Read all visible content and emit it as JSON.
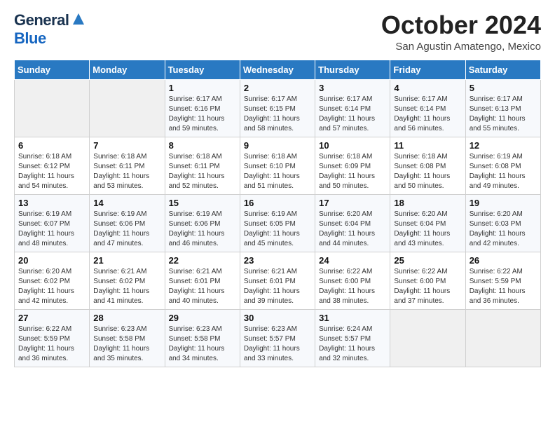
{
  "header": {
    "logo_general": "General",
    "logo_blue": "Blue",
    "month_title": "October 2024",
    "subtitle": "San Agustin Amatengo, Mexico"
  },
  "days_of_week": [
    "Sunday",
    "Monday",
    "Tuesday",
    "Wednesday",
    "Thursday",
    "Friday",
    "Saturday"
  ],
  "weeks": [
    [
      {
        "day": "",
        "sunrise": "",
        "sunset": "",
        "daylight": ""
      },
      {
        "day": "",
        "sunrise": "",
        "sunset": "",
        "daylight": ""
      },
      {
        "day": "1",
        "sunrise": "Sunrise: 6:17 AM",
        "sunset": "Sunset: 6:16 PM",
        "daylight": "Daylight: 11 hours and 59 minutes."
      },
      {
        "day": "2",
        "sunrise": "Sunrise: 6:17 AM",
        "sunset": "Sunset: 6:15 PM",
        "daylight": "Daylight: 11 hours and 58 minutes."
      },
      {
        "day": "3",
        "sunrise": "Sunrise: 6:17 AM",
        "sunset": "Sunset: 6:14 PM",
        "daylight": "Daylight: 11 hours and 57 minutes."
      },
      {
        "day": "4",
        "sunrise": "Sunrise: 6:17 AM",
        "sunset": "Sunset: 6:14 PM",
        "daylight": "Daylight: 11 hours and 56 minutes."
      },
      {
        "day": "5",
        "sunrise": "Sunrise: 6:17 AM",
        "sunset": "Sunset: 6:13 PM",
        "daylight": "Daylight: 11 hours and 55 minutes."
      }
    ],
    [
      {
        "day": "6",
        "sunrise": "Sunrise: 6:18 AM",
        "sunset": "Sunset: 6:12 PM",
        "daylight": "Daylight: 11 hours and 54 minutes."
      },
      {
        "day": "7",
        "sunrise": "Sunrise: 6:18 AM",
        "sunset": "Sunset: 6:11 PM",
        "daylight": "Daylight: 11 hours and 53 minutes."
      },
      {
        "day": "8",
        "sunrise": "Sunrise: 6:18 AM",
        "sunset": "Sunset: 6:11 PM",
        "daylight": "Daylight: 11 hours and 52 minutes."
      },
      {
        "day": "9",
        "sunrise": "Sunrise: 6:18 AM",
        "sunset": "Sunset: 6:10 PM",
        "daylight": "Daylight: 11 hours and 51 minutes."
      },
      {
        "day": "10",
        "sunrise": "Sunrise: 6:18 AM",
        "sunset": "Sunset: 6:09 PM",
        "daylight": "Daylight: 11 hours and 50 minutes."
      },
      {
        "day": "11",
        "sunrise": "Sunrise: 6:18 AM",
        "sunset": "Sunset: 6:08 PM",
        "daylight": "Daylight: 11 hours and 50 minutes."
      },
      {
        "day": "12",
        "sunrise": "Sunrise: 6:19 AM",
        "sunset": "Sunset: 6:08 PM",
        "daylight": "Daylight: 11 hours and 49 minutes."
      }
    ],
    [
      {
        "day": "13",
        "sunrise": "Sunrise: 6:19 AM",
        "sunset": "Sunset: 6:07 PM",
        "daylight": "Daylight: 11 hours and 48 minutes."
      },
      {
        "day": "14",
        "sunrise": "Sunrise: 6:19 AM",
        "sunset": "Sunset: 6:06 PM",
        "daylight": "Daylight: 11 hours and 47 minutes."
      },
      {
        "day": "15",
        "sunrise": "Sunrise: 6:19 AM",
        "sunset": "Sunset: 6:06 PM",
        "daylight": "Daylight: 11 hours and 46 minutes."
      },
      {
        "day": "16",
        "sunrise": "Sunrise: 6:19 AM",
        "sunset": "Sunset: 6:05 PM",
        "daylight": "Daylight: 11 hours and 45 minutes."
      },
      {
        "day": "17",
        "sunrise": "Sunrise: 6:20 AM",
        "sunset": "Sunset: 6:04 PM",
        "daylight": "Daylight: 11 hours and 44 minutes."
      },
      {
        "day": "18",
        "sunrise": "Sunrise: 6:20 AM",
        "sunset": "Sunset: 6:04 PM",
        "daylight": "Daylight: 11 hours and 43 minutes."
      },
      {
        "day": "19",
        "sunrise": "Sunrise: 6:20 AM",
        "sunset": "Sunset: 6:03 PM",
        "daylight": "Daylight: 11 hours and 42 minutes."
      }
    ],
    [
      {
        "day": "20",
        "sunrise": "Sunrise: 6:20 AM",
        "sunset": "Sunset: 6:02 PM",
        "daylight": "Daylight: 11 hours and 42 minutes."
      },
      {
        "day": "21",
        "sunrise": "Sunrise: 6:21 AM",
        "sunset": "Sunset: 6:02 PM",
        "daylight": "Daylight: 11 hours and 41 minutes."
      },
      {
        "day": "22",
        "sunrise": "Sunrise: 6:21 AM",
        "sunset": "Sunset: 6:01 PM",
        "daylight": "Daylight: 11 hours and 40 minutes."
      },
      {
        "day": "23",
        "sunrise": "Sunrise: 6:21 AM",
        "sunset": "Sunset: 6:01 PM",
        "daylight": "Daylight: 11 hours and 39 minutes."
      },
      {
        "day": "24",
        "sunrise": "Sunrise: 6:22 AM",
        "sunset": "Sunset: 6:00 PM",
        "daylight": "Daylight: 11 hours and 38 minutes."
      },
      {
        "day": "25",
        "sunrise": "Sunrise: 6:22 AM",
        "sunset": "Sunset: 6:00 PM",
        "daylight": "Daylight: 11 hours and 37 minutes."
      },
      {
        "day": "26",
        "sunrise": "Sunrise: 6:22 AM",
        "sunset": "Sunset: 5:59 PM",
        "daylight": "Daylight: 11 hours and 36 minutes."
      }
    ],
    [
      {
        "day": "27",
        "sunrise": "Sunrise: 6:22 AM",
        "sunset": "Sunset: 5:59 PM",
        "daylight": "Daylight: 11 hours and 36 minutes."
      },
      {
        "day": "28",
        "sunrise": "Sunrise: 6:23 AM",
        "sunset": "Sunset: 5:58 PM",
        "daylight": "Daylight: 11 hours and 35 minutes."
      },
      {
        "day": "29",
        "sunrise": "Sunrise: 6:23 AM",
        "sunset": "Sunset: 5:58 PM",
        "daylight": "Daylight: 11 hours and 34 minutes."
      },
      {
        "day": "30",
        "sunrise": "Sunrise: 6:23 AM",
        "sunset": "Sunset: 5:57 PM",
        "daylight": "Daylight: 11 hours and 33 minutes."
      },
      {
        "day": "31",
        "sunrise": "Sunrise: 6:24 AM",
        "sunset": "Sunset: 5:57 PM",
        "daylight": "Daylight: 11 hours and 32 minutes."
      },
      {
        "day": "",
        "sunrise": "",
        "sunset": "",
        "daylight": ""
      },
      {
        "day": "",
        "sunrise": "",
        "sunset": "",
        "daylight": ""
      }
    ]
  ]
}
